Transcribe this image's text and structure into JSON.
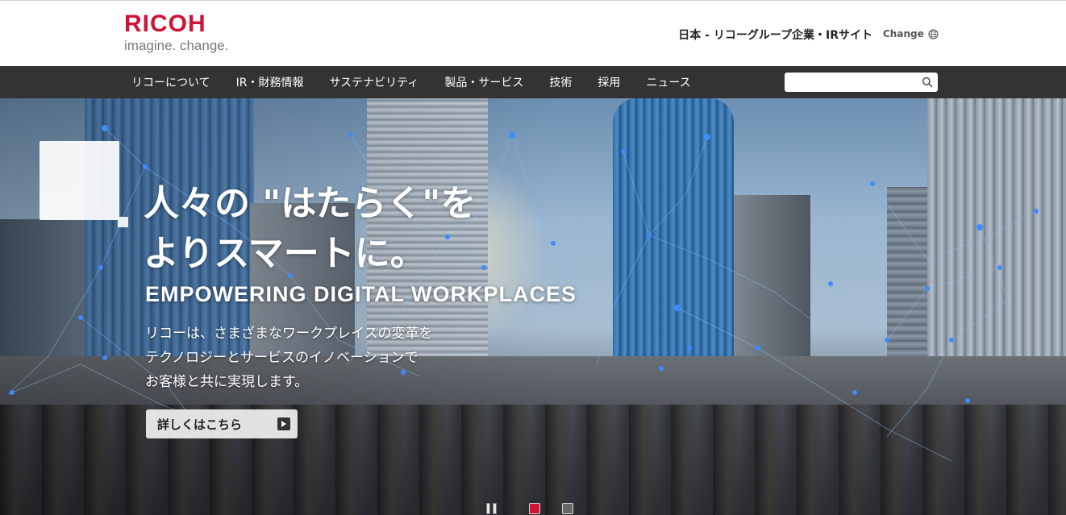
{
  "header": {
    "logo_word": "RICOH",
    "logo_tagline": "imagine. change.",
    "region": "日本 - リコーグループ企業・IRサイト",
    "change_label": "Change",
    "brand_color": "#cf1236"
  },
  "nav": {
    "items": [
      {
        "label": "リコーについて"
      },
      {
        "label": "IR・財務情報"
      },
      {
        "label": "サステナビリティ"
      },
      {
        "label": "製品・サービス"
      },
      {
        "label": "技術"
      },
      {
        "label": "採用"
      },
      {
        "label": "ニュース"
      }
    ],
    "search": {
      "value": "",
      "icon": "search-icon"
    }
  },
  "hero": {
    "title_line1": "人々の \"はたらく\"を",
    "title_line2": "よりスマートに。",
    "subtitle": "EMPOWERING DIGITAL WORKPLACES",
    "desc_line1": "リコーは、さまざまなワークプレイスの変革を",
    "desc_line2": "テクノロジーとサービスのイノベーションで",
    "desc_line3": "お客様と共に実現します。",
    "cta_label": "詳しくはこちら",
    "active_slide": 1,
    "slide_count": 2
  }
}
